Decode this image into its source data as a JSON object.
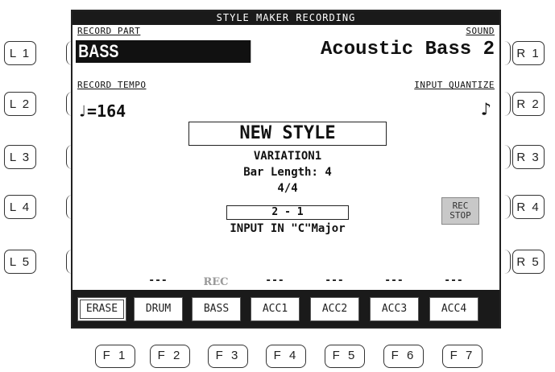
{
  "side_buttons": {
    "left": [
      "L 1",
      "L 2",
      "L 3",
      "L 4",
      "L 5"
    ],
    "right": [
      "R 1",
      "R 2",
      "R 3",
      "R 4",
      "R 5"
    ]
  },
  "screen": {
    "title": "STYLE MAKER RECORDING",
    "record_part_label": "RECORD PART",
    "record_part_value": "BASS",
    "sound_label": "SOUND",
    "sound_value": "Acoustic Bass 2",
    "record_tempo_label": "RECORD TEMPO",
    "tempo_value": "♩=164",
    "input_quantize_label": "INPUT QUANTIZE",
    "quantize_value": "♪",
    "style_name": "NEW STYLE",
    "variation": "VARIATION1",
    "bar_length": "Bar Length: 4",
    "time_signature": "4/4",
    "position": "2 - 1",
    "input_key": "INPUT IN \"C\"Major",
    "rec_stop": [
      "REC",
      "STOP"
    ]
  },
  "function_tracks": [
    {
      "status": "",
      "label": "ERASE"
    },
    {
      "status": "---",
      "label": "DRUM"
    },
    {
      "status": "REC",
      "label": "BASS"
    },
    {
      "status": "---",
      "label": "ACC1"
    },
    {
      "status": "---",
      "label": "ACC2"
    },
    {
      "status": "---",
      "label": "ACC3"
    },
    {
      "status": "---",
      "label": "ACC4"
    }
  ],
  "f_keys": [
    "F 1",
    "F 2",
    "F 3",
    "F 4",
    "F 5",
    "F 6",
    "F 7"
  ]
}
